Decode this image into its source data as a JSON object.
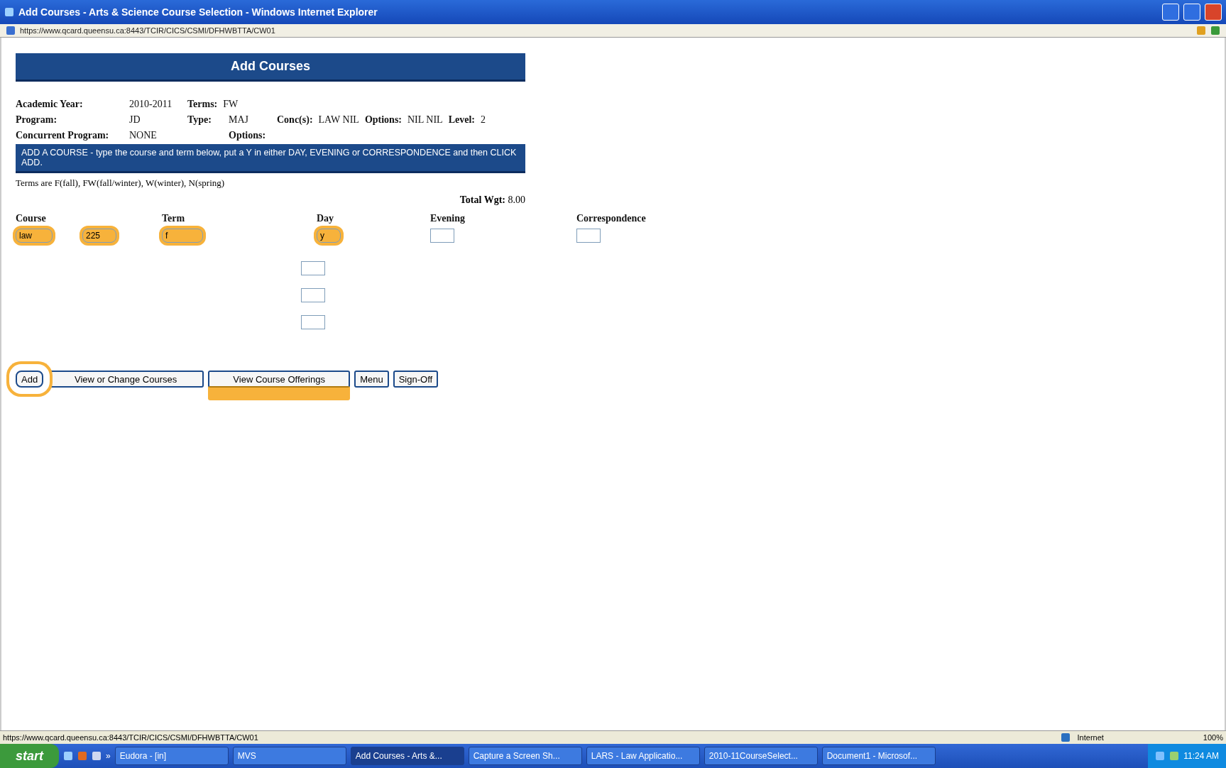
{
  "window": {
    "title": "Add Courses - Arts & Science Course Selection - Windows Internet Explorer"
  },
  "address_bar": {
    "url": "https://www.qcard.queensu.ca:8443/TCIR/CICS/CSMI/DFHWBTTA/CW01"
  },
  "page": {
    "heading": "Add Courses",
    "info_rows": [
      {
        "cells": [
          {
            "label": "Academic Year:",
            "value": "2010-2011"
          },
          {
            "label": "Terms:",
            "value": "FW"
          }
        ]
      },
      {
        "cells": [
          {
            "label": "Program:",
            "value": "JD"
          },
          {
            "label": "Type:",
            "value": "MAJ"
          },
          {
            "label": "Conc(s):",
            "value": "LAW NIL"
          },
          {
            "label": "Options:",
            "value": "NIL NIL"
          },
          {
            "label": "Level:",
            "value": "2"
          }
        ]
      },
      {
        "cells": [
          {
            "label": "Concurrent Program:",
            "value": "NONE"
          },
          {
            "label": "Options:"
          }
        ]
      }
    ],
    "instructions": "ADD A COURSE - type the course and term below, put a Y in either DAY, EVENING or CORRESPONDENCE and then CLICK ADD.",
    "terms_note": "Terms are F(fall), FW(fall/winter), W(winter), N(spring)",
    "total_weight": {
      "label": "Total Wgt:",
      "value": "8.00"
    },
    "columns": [
      "Course",
      "Term",
      "Day",
      "Evening",
      "Correspondence"
    ],
    "fields": {
      "course_subject": {
        "value": "law",
        "highlighted": true
      },
      "course_number": {
        "value": "225",
        "highlighted": true
      },
      "term": {
        "value": "f",
        "highlighted": true
      },
      "day": {
        "value": "y",
        "highlighted": true
      },
      "evening": {
        "highlighted": false
      },
      "correspondence": {
        "highlighted": false
      }
    },
    "extra_day_fields": [
      {
        "highlighted": false
      },
      {
        "highlighted": false
      },
      {
        "highlighted": false
      }
    ],
    "buttons": [
      {
        "label": "Add",
        "circled": true,
        "underlined": false
      },
      {
        "label": "View or Change Courses",
        "circled": false,
        "underlined": false
      },
      {
        "label": "View Course Offerings",
        "circled": false,
        "underlined": true
      },
      {
        "label": "Menu",
        "circled": false,
        "underlined": false
      },
      {
        "label": "Sign-Off",
        "circled": false,
        "underlined": false
      }
    ]
  },
  "status_bar": {
    "url": "https://www.qcard.queensu.ca:8443/TCIR/CICS/CSMI/DFHWBTTA/CW01",
    "zone": "Internet",
    "zoom": "100%"
  },
  "taskbar": {
    "start": "start",
    "quick_launch_more": "»",
    "tasks": [
      {
        "label": "Eudora - [in]",
        "selected": false
      },
      {
        "label": "MVS",
        "selected": false
      },
      {
        "label": "Add Courses - Arts &...",
        "selected": true
      },
      {
        "label": "Capture a Screen Sh...",
        "selected": false
      },
      {
        "label": "LARS - Law Applicatio...",
        "selected": false
      },
      {
        "label": "2010-11CourseSelect...",
        "selected": false
      },
      {
        "label": "Document1 - Microsof...",
        "selected": false
      }
    ],
    "clock": "11:24 AM"
  }
}
